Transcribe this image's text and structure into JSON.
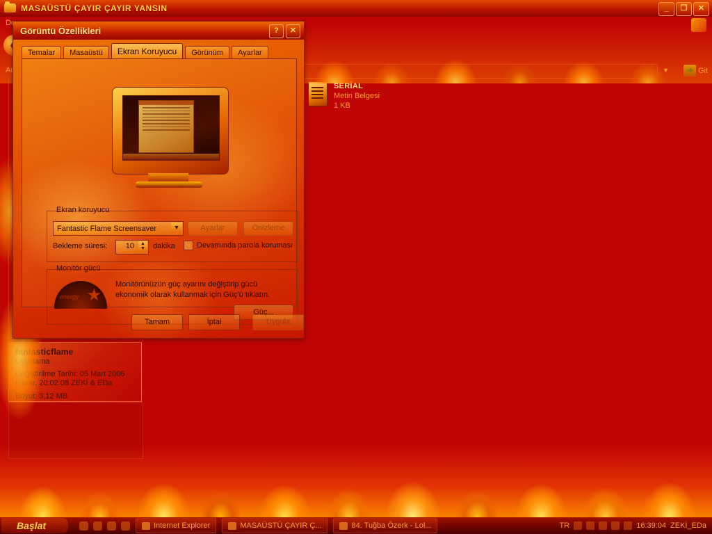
{
  "explorer": {
    "title": "MASAÜSTÜ ÇAYIR ÇAYIR YANSIN",
    "folder_icon": "folder-icon",
    "menu_label": "Do",
    "address_label": "Adres",
    "go_label": "Git",
    "buttons": {
      "minimize": "_",
      "restore": "❐",
      "close": "✕"
    },
    "details": {
      "name": "fantasticflame",
      "type": "Uygulama",
      "modified_line1": "Değiştirilme Tarihi: 05 Mart 2006",
      "modified_line2": "Pazar, 20:02:08   ZEKİ & EDa",
      "size": "Boyut: 3,12 MB"
    },
    "file": {
      "name": "SERİAL",
      "type": "Metin Belgesi",
      "size": "1 KB"
    }
  },
  "dialog": {
    "title": "Görüntü Özellikleri",
    "help_btn": "?",
    "close_btn": "✕",
    "tabs": [
      {
        "label": "Temalar",
        "active": false
      },
      {
        "label": "Masaüstü",
        "active": false
      },
      {
        "label": "Ekran Koruyucu",
        "active": true
      },
      {
        "label": "Görünüm",
        "active": false
      },
      {
        "label": "Ayarlar",
        "active": false
      }
    ],
    "screensaver_group": {
      "legend": "Ekran koruyucu",
      "selected": "Fantastic Flame Screensaver",
      "dropdown_icon": "chevron-down-icon",
      "settings_btn": "Ayarlar",
      "preview_btn": "Önizleme",
      "wait_label": "Bekleme süresi:",
      "wait_value": "10",
      "minutes_label": "dakika",
      "password_label": "Devamında parola koruması",
      "password_checked": false
    },
    "power_group": {
      "legend": "Monitör gücü",
      "description": "Monitörünüzün güç ayarını değiştirip gücü ekonomik olarak kullanmak için Güç'ü tıklatın.",
      "energy_star_text": "energy",
      "power_btn": "Güç..."
    },
    "footer": {
      "ok": "Tamam",
      "cancel": "İptal",
      "apply": "Uygula",
      "apply_disabled": true
    }
  },
  "taskbar": {
    "start": "Başlat",
    "quick_launch": [
      "show-desktop-icon",
      "ie-icon",
      "media-icon",
      "opera-icon"
    ],
    "items": [
      {
        "label": "Internet Explorer",
        "icon": "ie-icon"
      },
      {
        "label": "MASAÜSTÜ ÇAYIR Ç...",
        "icon": "folder-icon"
      },
      {
        "label": "84. Tuğba Özerk - Lol...",
        "icon": "media-icon"
      }
    ],
    "tray": {
      "language": "TR",
      "clock": "16:39:04",
      "user": "ZEKİ_EDa"
    }
  },
  "colors": {
    "desktop_red": "#c00505",
    "flame_orange": "#ff8a00",
    "flame_yellow": "#ffe24a",
    "title_text": "#ffd24a"
  }
}
